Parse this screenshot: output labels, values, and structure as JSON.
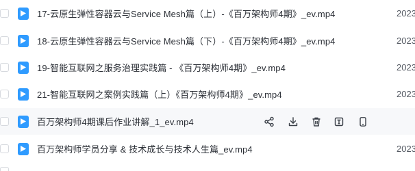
{
  "files": [
    {
      "name": "17-云原生弹性容器云与Service Mesh篇（上）-《百万架构师4期》_ev.mp4",
      "date": "2023"
    },
    {
      "name": "18-云原生弹性容器云与Service Mesh篇（下）-《百万架构师4期》_ev.mp4",
      "date": "2023"
    },
    {
      "name": "19-智能互联网之服务治理实践篇 - 《百万架构师4期》_ev.mp4",
      "date": "2023"
    },
    {
      "name": "21-智能互联网之案例实践篇（上）《百万架构师4期》_ev.mp4",
      "date": "2023"
    },
    {
      "name": "百万架构师4期课后作业讲解_1_ev.mp4",
      "date": ""
    },
    {
      "name": "百万架构师学员分享 & 技术成长与技术人生篇_ev.mp4",
      "date": "2023"
    }
  ],
  "icons": {
    "file": "video-file-icon",
    "share": "share-icon",
    "download": "download-icon",
    "delete": "trash-icon",
    "rename": "rename-icon",
    "mobile": "mobile-phone-icon"
  },
  "colors": {
    "file_icon": "#2f9bff",
    "hover_row": "#f7f8fa"
  }
}
